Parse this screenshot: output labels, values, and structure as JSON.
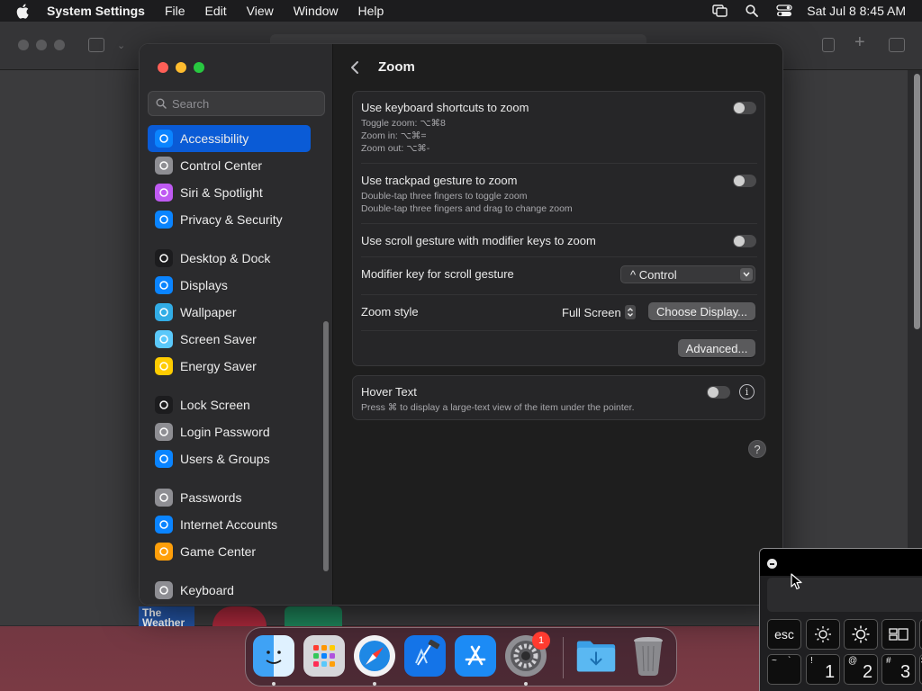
{
  "menubar": {
    "app_name": "System Settings",
    "menus": [
      "File",
      "Edit",
      "View",
      "Window",
      "Help"
    ],
    "clock": "Sat Jul 8  8:45 AM"
  },
  "settings": {
    "search_placeholder": "Search",
    "sidebar": [
      {
        "label": "Accessibility",
        "icon": "accessibility-icon",
        "color": "#0a84ff",
        "selected": true
      },
      {
        "label": "Control Center",
        "icon": "control-center-icon",
        "color": "#8e8e93"
      },
      {
        "label": "Siri & Spotlight",
        "icon": "siri-icon",
        "color": "#bf5af2"
      },
      {
        "label": "Privacy & Security",
        "icon": "hand-icon",
        "color": "#0a84ff"
      },
      {
        "label": "Desktop & Dock",
        "icon": "dock-icon",
        "color": "#1c1c1e"
      },
      {
        "label": "Displays",
        "icon": "sun-icon",
        "color": "#0a84ff"
      },
      {
        "label": "Wallpaper",
        "icon": "wallpaper-icon",
        "color": "#32ade6"
      },
      {
        "label": "Screen Saver",
        "icon": "screen-saver-icon",
        "color": "#5ac8fa"
      },
      {
        "label": "Energy Saver",
        "icon": "bulb-icon",
        "color": "#ffcc00"
      },
      {
        "label": "Lock Screen",
        "icon": "lock-icon",
        "color": "#1c1c1e"
      },
      {
        "label": "Login Password",
        "icon": "key-lock-icon",
        "color": "#8e8e93"
      },
      {
        "label": "Users & Groups",
        "icon": "users-icon",
        "color": "#0a84ff"
      },
      {
        "label": "Passwords",
        "icon": "key-icon",
        "color": "#8e8e93"
      },
      {
        "label": "Internet Accounts",
        "icon": "at-icon",
        "color": "#0a84ff"
      },
      {
        "label": "Game Center",
        "icon": "game-center-icon",
        "color": "#ff9f0a"
      },
      {
        "label": "Keyboard",
        "icon": "keyboard-icon",
        "color": "#8e8e93"
      }
    ],
    "pane_title": "Zoom",
    "keyboard_shortcuts": {
      "title": "Use keyboard shortcuts to zoom",
      "lines": [
        "Toggle zoom: ⌥⌘8",
        "Zoom in: ⌥⌘=",
        "Zoom out: ⌥⌘-"
      ],
      "enabled": false
    },
    "trackpad_gesture": {
      "title": "Use trackpad gesture to zoom",
      "lines": [
        "Double-tap three fingers to toggle zoom",
        "Double-tap three fingers and drag to change zoom"
      ],
      "enabled": false
    },
    "scroll_gesture": {
      "title": "Use scroll gesture with modifier keys to zoom",
      "enabled": false
    },
    "modifier_key": {
      "label": "Modifier key for scroll gesture",
      "value": "^ Control"
    },
    "zoom_style": {
      "label": "Zoom style",
      "value": "Full Screen",
      "choose_display_label": "Choose Display..."
    },
    "advanced_label": "Advanced...",
    "hover_text": {
      "title": "Hover Text",
      "description": "Press ⌘ to display a large-text view of the item under the pointer.",
      "enabled": false
    },
    "help_label": "?"
  },
  "background_window": {
    "thumb_text": "The Weather"
  },
  "dock": {
    "apps": [
      "finder-icon",
      "launchpad-icon",
      "safari-icon",
      "xcode-icon",
      "app-store-icon",
      "system-settings-icon",
      "downloads-folder-icon",
      "trash-icon"
    ],
    "settings_badge": "1"
  },
  "keyboard_viewer": {
    "function_row": [
      "esc"
    ],
    "number_row": [
      {
        "top": "~",
        "bottom": "`"
      },
      {
        "top": "!",
        "bottom": "1"
      },
      {
        "top": "@",
        "bottom": "2"
      },
      {
        "top": "#",
        "bottom": "3"
      },
      {
        "top": "$",
        "bottom": ""
      }
    ]
  }
}
